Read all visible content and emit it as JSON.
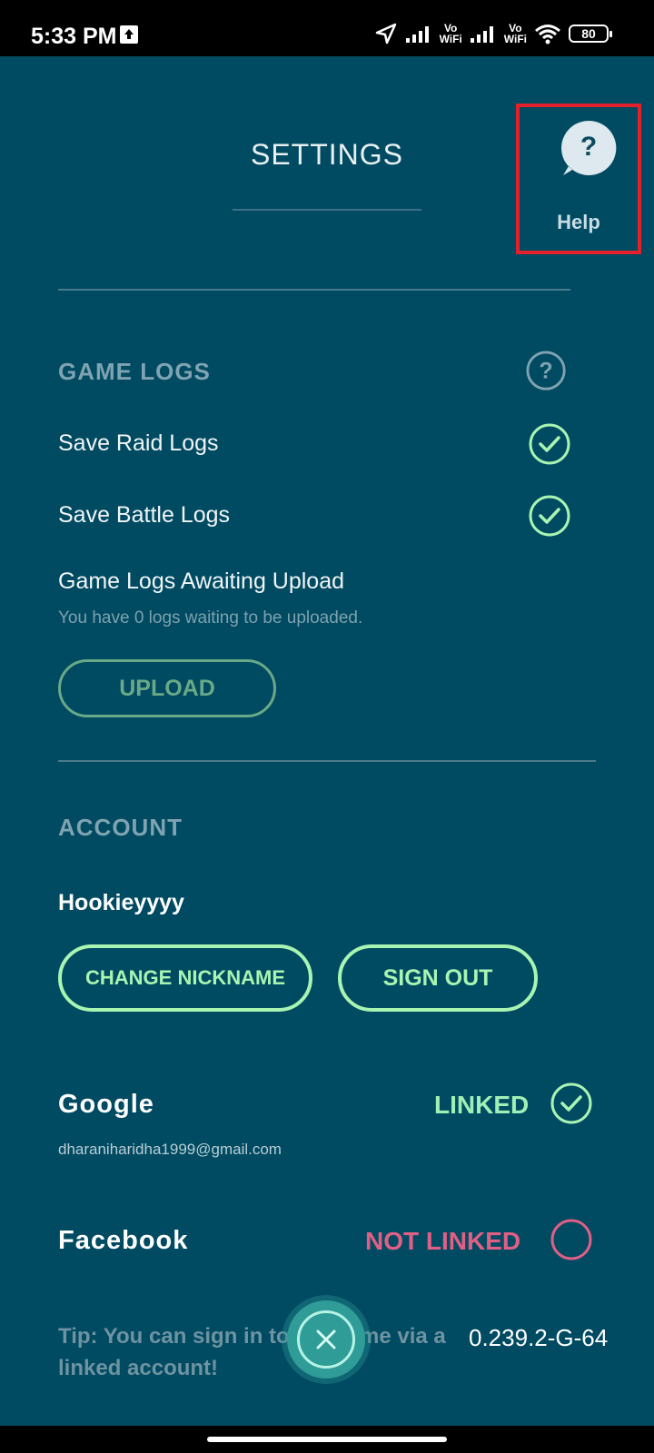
{
  "status_bar": {
    "time": "5:33 PM",
    "network_label": "Vo\nWiFi",
    "battery": "80"
  },
  "header": {
    "title": "SETTINGS",
    "help_label": "Help"
  },
  "game_logs": {
    "section_title": "GAME LOGS",
    "save_raid_logs": "Save Raid Logs",
    "save_battle_logs": "Save Battle Logs",
    "awaiting_title": "Game Logs Awaiting Upload",
    "awaiting_sub": "You have 0 logs waiting to be uploaded.",
    "upload_button": "UPLOAD"
  },
  "account": {
    "section_title": "ACCOUNT",
    "nickname": "Hookieyyyy",
    "change_nickname_button": "CHANGE NICKNAME",
    "sign_out_button": "SIGN OUT",
    "google_label": "Google",
    "google_status": "LINKED",
    "google_email": "dharaniharidha1999@gmail.com",
    "facebook_label": "Facebook",
    "facebook_status": "NOT LINKED"
  },
  "footer": {
    "tip": "Tip: You can sign in to the game via a linked account!",
    "version": "0.239.2-G-64"
  },
  "colors": {
    "background": "#004a62",
    "accent_green": "#a8f5b2",
    "dim_green": "#6aa987",
    "not_linked": "#e05f84",
    "highlight_red": "#e4202c"
  }
}
